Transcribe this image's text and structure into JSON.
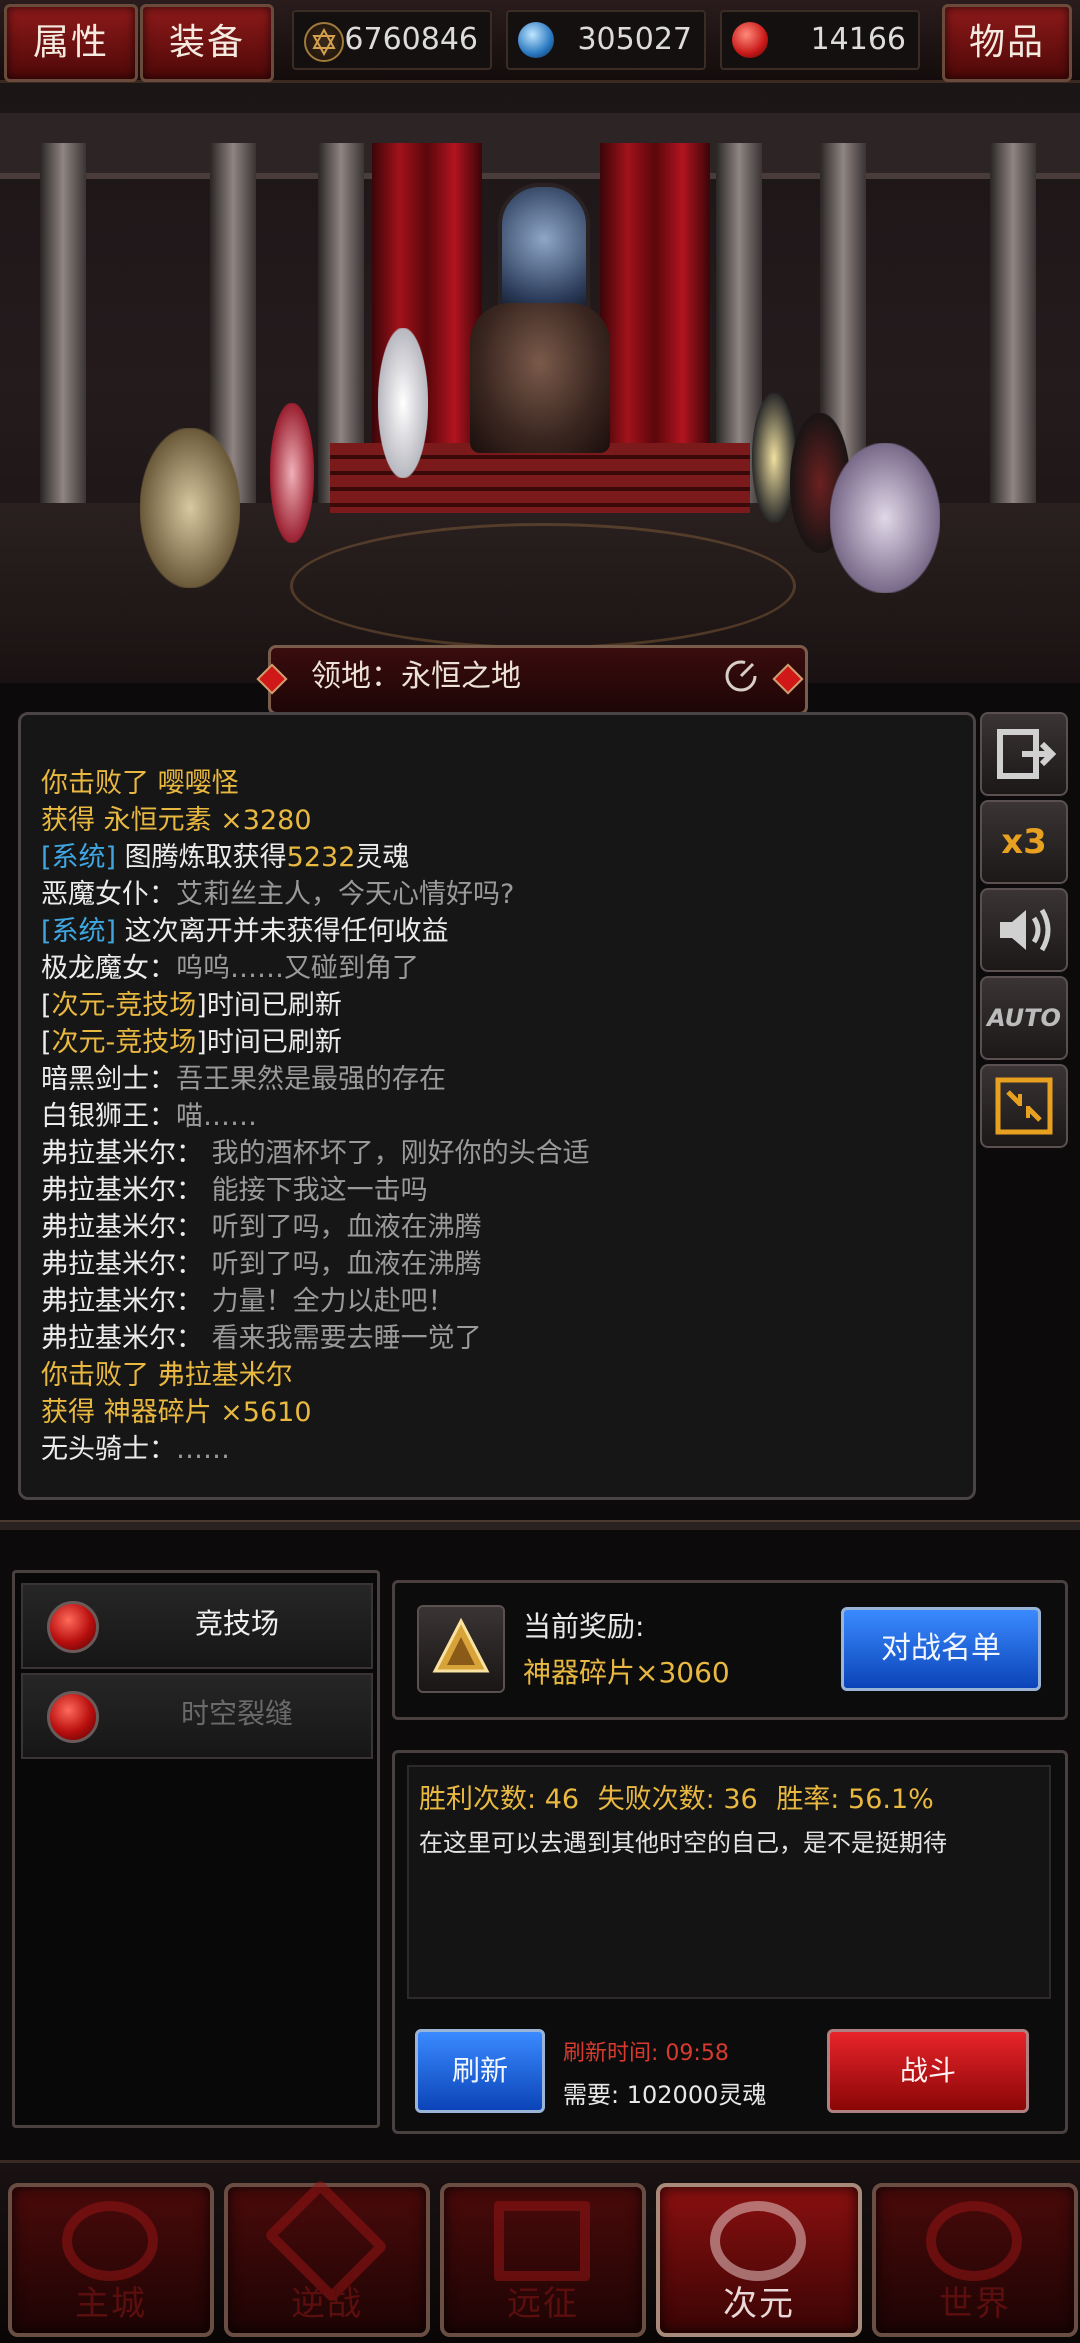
{
  "top_bar": {
    "tab_attributes": "属性",
    "tab_equipment": "装备",
    "tab_items": "物品",
    "resources": [
      {
        "icon": "hexagram-gold-icon",
        "value": "6760846"
      },
      {
        "icon": "blue-orb-icon",
        "value": "305027"
      },
      {
        "icon": "red-rune-icon",
        "value": "14166"
      }
    ]
  },
  "scene": {
    "domain_label": "领地：永恒之地",
    "refresh_icon": "refresh-icon"
  },
  "log": {
    "lines": [
      {
        "segments": [
          {
            "text": "你击败了 嘤嘤怪",
            "color": "gold"
          }
        ]
      },
      {
        "segments": [
          {
            "text": "获得 永恒元素 ×3280",
            "color": "gold"
          }
        ]
      },
      {
        "segments": [
          {
            "text": "[系统]",
            "color": "cyan"
          },
          {
            "text": " 图腾炼取获得",
            "color": "white"
          },
          {
            "text": "5232",
            "color": "gold"
          },
          {
            "text": "灵魂",
            "color": "white"
          }
        ]
      },
      {
        "segments": [
          {
            "text": "恶魔女仆：",
            "color": "white"
          },
          {
            "text": "艾莉丝主人，今天心情好吗?",
            "color": "gray"
          }
        ]
      },
      {
        "segments": [
          {
            "text": "[系统]",
            "color": "cyan"
          },
          {
            "text": " 这次离开并未获得任何收益",
            "color": "white"
          }
        ]
      },
      {
        "segments": [
          {
            "text": "极龙魔女：",
            "color": "white"
          },
          {
            "text": "呜呜……又碰到角了",
            "color": "gray"
          }
        ]
      },
      {
        "segments": [
          {
            "text": "[",
            "color": "white"
          },
          {
            "text": "次元-竞技场",
            "color": "gold"
          },
          {
            "text": "]时间已刷新",
            "color": "white"
          }
        ]
      },
      {
        "segments": [
          {
            "text": "[",
            "color": "white"
          },
          {
            "text": "次元-竞技场",
            "color": "gold"
          },
          {
            "text": "]时间已刷新",
            "color": "white"
          }
        ]
      },
      {
        "segments": [
          {
            "text": "暗黑剑士：",
            "color": "white"
          },
          {
            "text": "吾王果然是最强的存在",
            "color": "gray"
          }
        ]
      },
      {
        "segments": [
          {
            "text": "白银狮王：",
            "color": "white"
          },
          {
            "text": "喵……",
            "color": "gray"
          }
        ]
      },
      {
        "segments": [
          {
            "text": "弗拉基米尔：",
            "color": "white"
          },
          {
            "text": " 我的酒杯坏了，刚好你的头合适",
            "color": "gray"
          }
        ]
      },
      {
        "segments": [
          {
            "text": "弗拉基米尔：",
            "color": "white"
          },
          {
            "text": " 能接下我这一击吗",
            "color": "gray"
          }
        ]
      },
      {
        "segments": [
          {
            "text": "弗拉基米尔：",
            "color": "white"
          },
          {
            "text": " 听到了吗，血液在沸腾",
            "color": "gray"
          }
        ]
      },
      {
        "segments": [
          {
            "text": "弗拉基米尔：",
            "color": "white"
          },
          {
            "text": " 听到了吗，血液在沸腾",
            "color": "gray"
          }
        ]
      },
      {
        "segments": [
          {
            "text": "弗拉基米尔：",
            "color": "white"
          },
          {
            "text": " 力量！全力以赴吧！",
            "color": "gray"
          }
        ]
      },
      {
        "segments": [
          {
            "text": "弗拉基米尔：",
            "color": "white"
          },
          {
            "text": " 看来我需要去睡一觉了",
            "color": "gray"
          }
        ]
      },
      {
        "segments": [
          {
            "text": "你击败了 弗拉基米尔",
            "color": "gold"
          }
        ]
      },
      {
        "segments": [
          {
            "text": "获得 神器碎片 ×5610",
            "color": "gold"
          }
        ]
      },
      {
        "segments": [
          {
            "text": "无头骑士：",
            "color": "white"
          },
          {
            "text": "……",
            "color": "gray"
          }
        ]
      }
    ]
  },
  "side_buttons": {
    "exit_icon": "exit-icon",
    "speed_label": "x3",
    "sound_icon": "speaker-icon",
    "auto_label": "AUTO",
    "collapse_icon": "collapse-icon"
  },
  "menu": {
    "items": [
      {
        "label": "竞技场",
        "active": true
      },
      {
        "label": "时空裂缝",
        "active": false
      }
    ]
  },
  "reward": {
    "title": "当前奖励:",
    "value": "神器碎片×3060",
    "roster_button": "对战名单"
  },
  "stats": {
    "wins_label": "胜利次数:",
    "wins": "46",
    "losses_label": "失败次数:",
    "losses": "36",
    "rate_label": "胜率:",
    "rate": "56.1%",
    "description": "在这里可以去遇到其他时空的自己，是不是挺期待"
  },
  "actions": {
    "refresh_button": "刷新",
    "refresh_time_label": "刷新时间:",
    "refresh_time": "09:58",
    "cost_label": "需要:",
    "cost_value": "102000灵魂",
    "fight_button": "战斗"
  },
  "nav": {
    "items": [
      {
        "label": "主城",
        "icon": "sun-gear-icon"
      },
      {
        "label": "逆战",
        "icon": "crossed-swords-icon"
      },
      {
        "label": "远征",
        "icon": "banner-icon"
      },
      {
        "label": "次元",
        "icon": "rift-icon"
      },
      {
        "label": "世界",
        "icon": "globe-icon"
      }
    ],
    "active": "次元"
  },
  "colors": {
    "gold": "#e8b840",
    "cyan": "#3fa6e0",
    "gray": "#9a9a9a",
    "crimson": "#d83a2e"
  }
}
